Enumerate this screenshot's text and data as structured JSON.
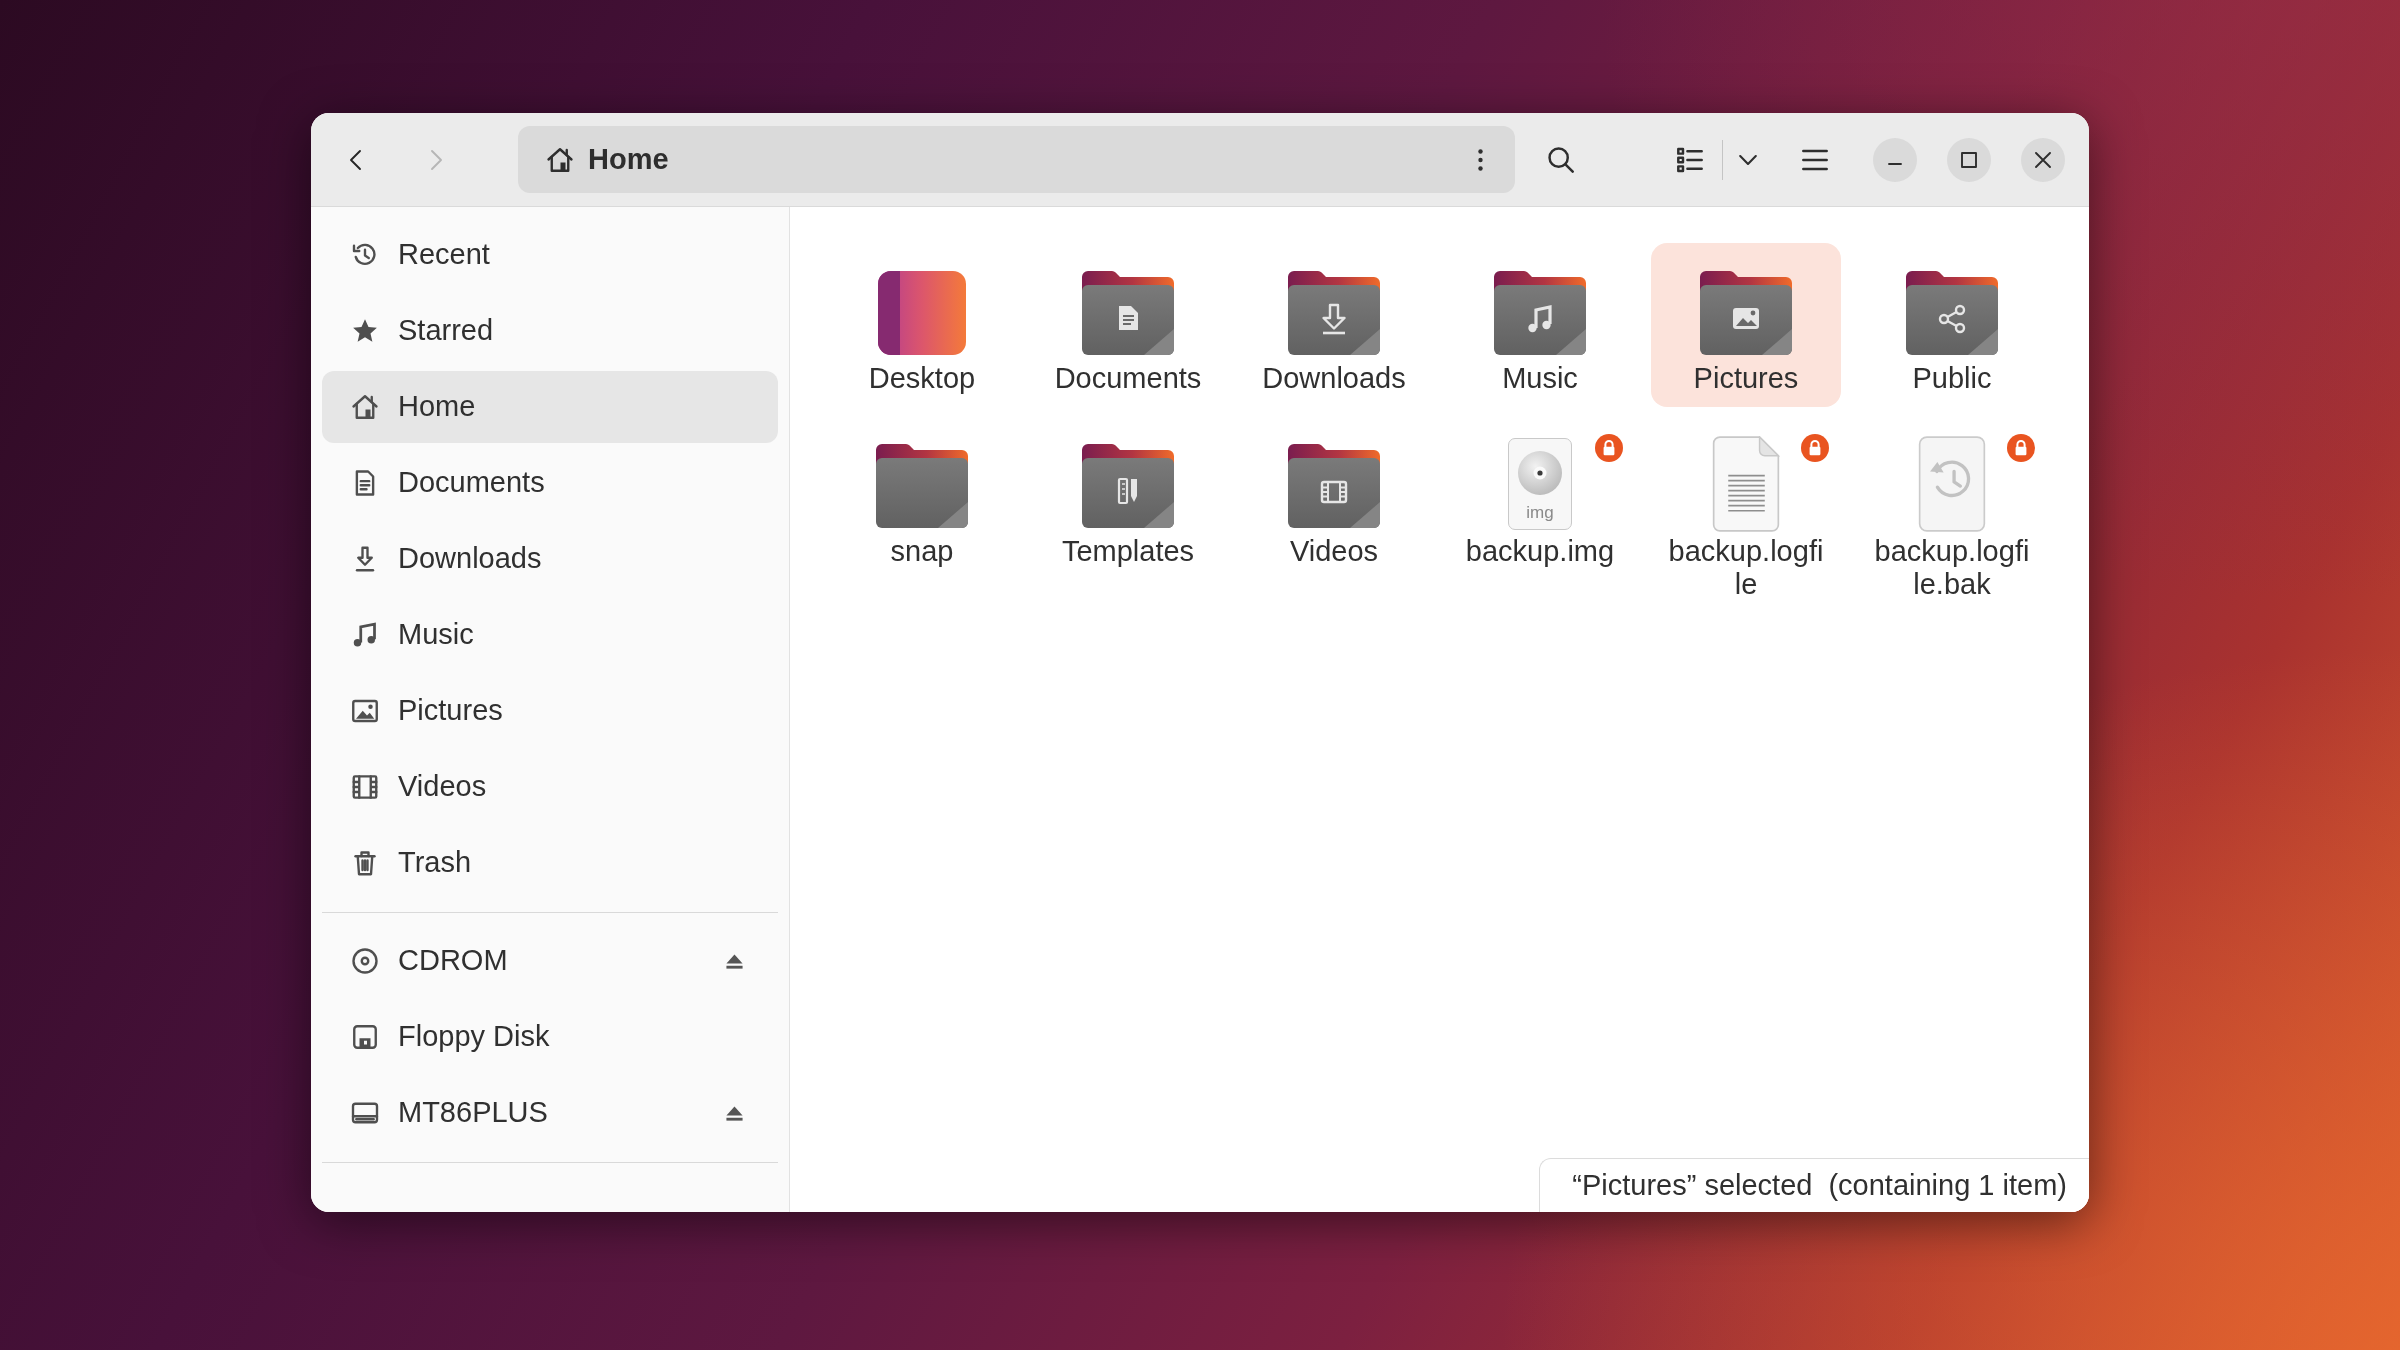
{
  "header": {
    "nav_buttons": [
      {
        "kind": "back",
        "disabled": false
      },
      {
        "kind": "forward",
        "disabled": true
      }
    ],
    "path": {
      "kind": "home",
      "label": "Home"
    }
  },
  "sidebar": {
    "groups": [
      {
        "items": [
          {
            "kind": "recent",
            "label": "Recent",
            "selected": false
          },
          {
            "kind": "starred",
            "label": "Starred",
            "selected": false
          },
          {
            "kind": "home",
            "label": "Home",
            "selected": true
          },
          {
            "kind": "documents",
            "label": "Documents",
            "selected": false
          },
          {
            "kind": "downloads",
            "label": "Downloads",
            "selected": false
          },
          {
            "kind": "music",
            "label": "Music",
            "selected": false
          },
          {
            "kind": "pictures",
            "label": "Pictures",
            "selected": false
          },
          {
            "kind": "videos",
            "label": "Videos",
            "selected": false
          },
          {
            "kind": "trash",
            "label": "Trash",
            "selected": false
          }
        ]
      },
      {
        "items": [
          {
            "kind": "cdrom",
            "label": "CDROM",
            "selected": false,
            "eject": true
          },
          {
            "kind": "floppy",
            "label": "Floppy Disk",
            "selected": false,
            "eject": false
          },
          {
            "kind": "drive",
            "label": "MT86PLUS",
            "selected": false,
            "eject": true
          }
        ]
      }
    ]
  },
  "files": [
    {
      "kind": "desktop",
      "name": "Desktop",
      "selected": false,
      "locked": false
    },
    {
      "kind": "documents",
      "name": "Documents",
      "selected": false,
      "locked": false
    },
    {
      "kind": "downloads",
      "name": "Downloads",
      "selected": false,
      "locked": false
    },
    {
      "kind": "music",
      "name": "Music",
      "selected": false,
      "locked": false
    },
    {
      "kind": "pictures",
      "name": "Pictures",
      "selected": true,
      "locked": false
    },
    {
      "kind": "public",
      "name": "Public",
      "selected": false,
      "locked": false
    },
    {
      "kind": "folder",
      "name": "snap",
      "selected": false,
      "locked": false
    },
    {
      "kind": "templates",
      "name": "Templates",
      "selected": false,
      "locked": false
    },
    {
      "kind": "videos",
      "name": "Videos",
      "selected": false,
      "locked": false
    },
    {
      "kind": "image",
      "name": "backup.img",
      "icon_text": "img",
      "selected": false,
      "locked": true
    },
    {
      "kind": "text",
      "name": "backup.logfile",
      "selected": false,
      "locked": true
    },
    {
      "kind": "backup",
      "name": "backup.logfile.bak",
      "selected": false,
      "locked": true
    }
  ],
  "status_bar": {
    "selection": "“Pictures” selected",
    "detail": "(containing 1 item)"
  }
}
